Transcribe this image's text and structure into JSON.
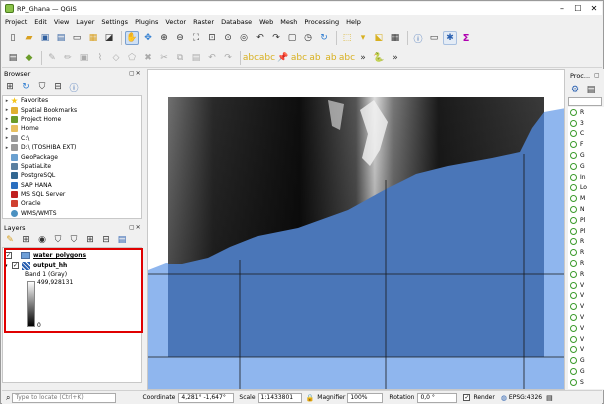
{
  "window": {
    "title": "RP_Ghana — QGIS"
  },
  "menu": [
    "Project",
    "Edit",
    "View",
    "Layer",
    "Settings",
    "Plugins",
    "Vector",
    "Raster",
    "Database",
    "Web",
    "Mesh",
    "Processing",
    "Help"
  ],
  "browser": {
    "title": "Browser",
    "items": [
      {
        "label": "Favorites",
        "color": "#f5c518"
      },
      {
        "label": "Spatial Bookmarks",
        "color": "#e0b030"
      },
      {
        "label": "Project Home",
        "color": "#6b9c2a"
      },
      {
        "label": "Home",
        "color": "#e8c060"
      },
      {
        "label": "C:\\",
        "color": "#9a9a9a"
      },
      {
        "label": "D:\\ (TOSHIBA EXT)",
        "color": "#9a9a9a"
      },
      {
        "label": "GeoPackage",
        "color": "#6aa0d0"
      },
      {
        "label": "SpatiaLite",
        "color": "#5a7fa0"
      },
      {
        "label": "PostgreSQL",
        "color": "#336791"
      },
      {
        "label": "SAP HANA",
        "color": "#2a6fc0"
      },
      {
        "label": "MS SQL Server",
        "color": "#c02020"
      },
      {
        "label": "Oracle",
        "color": "#d04030"
      },
      {
        "label": "WMS/WMTS",
        "color": "#4a90c0"
      }
    ]
  },
  "layers": {
    "title": "Layers",
    "items": [
      {
        "name": "water_polygons",
        "checked": "✓",
        "color": "#6e9fd8"
      },
      {
        "name": "output_hh",
        "checked": "✓"
      }
    ],
    "legend": {
      "band": "Band 1 (Gray)",
      "max": "499,928131",
      "min": "0"
    }
  },
  "processing": {
    "title": "Proc...",
    "items": [
      "R",
      "3",
      "C",
      "F",
      "G",
      "G",
      "In",
      "Lo",
      "M",
      "N",
      "Pl",
      "Pl",
      "R",
      "R",
      "R",
      "R",
      "V",
      "V",
      "V",
      "V",
      "V",
      "V",
      "V",
      "G",
      "G",
      "S"
    ]
  },
  "status": {
    "locate_placeholder": "Type to locate (Ctrl+K)",
    "coordinate_label": "Coordinate",
    "coordinate_value": "4,281° -1,647°",
    "scale_label": "Scale",
    "scale_value": "1:1433801",
    "magnifier_label": "Magnifier",
    "magnifier_value": "100%",
    "rotation_label": "Rotation",
    "rotation_value": "0,0 °",
    "render_label": "Render",
    "render_checked": "✓",
    "crs": "EPSG:4326"
  }
}
